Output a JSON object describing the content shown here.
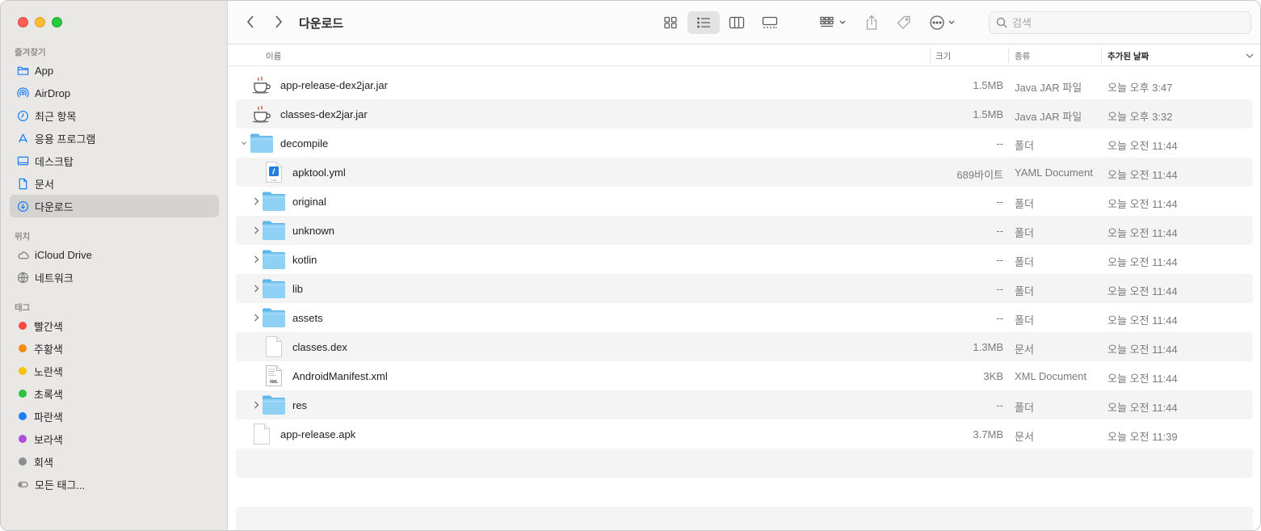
{
  "window": {
    "title": "다운로드"
  },
  "sidebar": {
    "favorites_title": "즐겨찾기",
    "favorites": [
      {
        "label": "App",
        "icon": "folder-icon"
      },
      {
        "label": "AirDrop",
        "icon": "airdrop-icon"
      },
      {
        "label": "최근 항목",
        "icon": "clock-icon"
      },
      {
        "label": "응용 프로그램",
        "icon": "applications-icon"
      },
      {
        "label": "데스크탑",
        "icon": "desktop-icon"
      },
      {
        "label": "문서",
        "icon": "document-icon"
      },
      {
        "label": "다운로드",
        "icon": "download-icon",
        "active": true
      }
    ],
    "locations_title": "위치",
    "locations": [
      {
        "label": "iCloud Drive",
        "icon": "cloud-icon"
      },
      {
        "label": "네트워크",
        "icon": "network-icon"
      }
    ],
    "tags_title": "태그",
    "tags": [
      {
        "label": "빨간색",
        "color": "#fe4740"
      },
      {
        "label": "주황색",
        "color": "#f7890b"
      },
      {
        "label": "노란색",
        "color": "#f5c400"
      },
      {
        "label": "초록색",
        "color": "#2bc23e"
      },
      {
        "label": "파란색",
        "color": "#1a7ef5"
      },
      {
        "label": "보라색",
        "color": "#ad4fd6"
      },
      {
        "label": "회색",
        "color": "#8d8d8d"
      }
    ],
    "all_tags": "모든 태그..."
  },
  "toolbar": {
    "search_placeholder": "검색"
  },
  "columns": {
    "name": "이름",
    "size": "크기",
    "kind": "종류",
    "date_added": "추가된 날짜"
  },
  "files": [
    {
      "name": "app-release-dex2jar.jar",
      "size": "1.5MB",
      "kind": "Java JAR 파일",
      "date": "오늘 오후 3:47",
      "icon": "java-jar-icon",
      "depth": 0
    },
    {
      "name": "classes-dex2jar.jar",
      "size": "1.5MB",
      "kind": "Java JAR 파일",
      "date": "오늘 오후 3:32",
      "icon": "java-jar-icon",
      "depth": 0
    },
    {
      "name": "decompile",
      "size": "--",
      "kind": "폴더",
      "date": "오늘 오전 11:44",
      "icon": "folder-icon",
      "depth": 0,
      "disclosure": "expanded"
    },
    {
      "name": "apktool.yml",
      "size": "689바이트",
      "kind": "YAML Document",
      "date": "오늘 오전 11:44",
      "icon": "yaml-file-icon",
      "depth": 1
    },
    {
      "name": "original",
      "size": "--",
      "kind": "폴더",
      "date": "오늘 오전 11:44",
      "icon": "folder-icon",
      "depth": 1,
      "disclosure": "collapsed"
    },
    {
      "name": "unknown",
      "size": "--",
      "kind": "폴더",
      "date": "오늘 오전 11:44",
      "icon": "folder-icon",
      "depth": 1,
      "disclosure": "collapsed"
    },
    {
      "name": "kotlin",
      "size": "--",
      "kind": "폴더",
      "date": "오늘 오전 11:44",
      "icon": "folder-icon",
      "depth": 1,
      "disclosure": "collapsed"
    },
    {
      "name": "lib",
      "size": "--",
      "kind": "폴더",
      "date": "오늘 오전 11:44",
      "icon": "folder-icon",
      "depth": 1,
      "disclosure": "collapsed"
    },
    {
      "name": "assets",
      "size": "--",
      "kind": "폴더",
      "date": "오늘 오전 11:44",
      "icon": "folder-icon",
      "depth": 1,
      "disclosure": "collapsed"
    },
    {
      "name": "classes.dex",
      "size": "1.3MB",
      "kind": "문서",
      "date": "오늘 오전 11:44",
      "icon": "blank-file-icon",
      "depth": 1
    },
    {
      "name": "AndroidManifest.xml",
      "size": "3KB",
      "kind": "XML Document",
      "date": "오늘 오전 11:44",
      "icon": "xml-file-icon",
      "depth": 1
    },
    {
      "name": "res",
      "size": "--",
      "kind": "폴더",
      "date": "오늘 오전 11:44",
      "icon": "folder-icon",
      "depth": 1,
      "disclosure": "collapsed"
    },
    {
      "name": "app-release.apk",
      "size": "3.7MB",
      "kind": "문서",
      "date": "오늘 오전 11:39",
      "icon": "blank-file-icon",
      "depth": 0
    }
  ]
}
